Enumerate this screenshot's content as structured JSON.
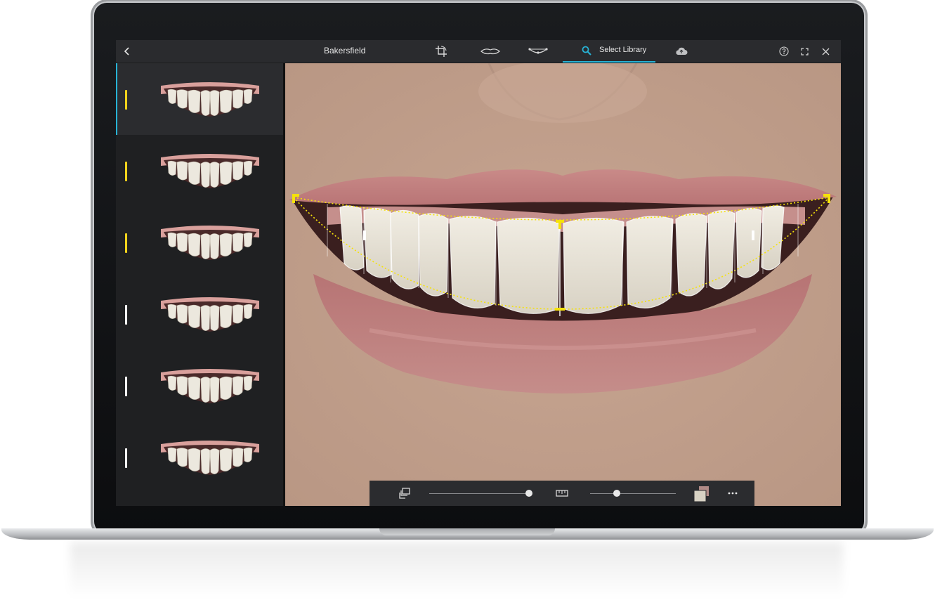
{
  "toolbar": {
    "back_icon": "chevron-left-icon",
    "title": "Bakersfield",
    "tools": [
      {
        "name": "crop-rotate-icon"
      },
      {
        "name": "lip-outline-icon"
      },
      {
        "name": "smile-curve-icon"
      }
    ],
    "active_tab_label": "Select Library",
    "active_tab_icon": "search-icon",
    "upload_icon": "cloud-upload-icon",
    "help_icon": "help-icon",
    "fullscreen_icon": "fullscreen-icon",
    "close_icon": "close-icon",
    "accent_color": "#27b3d6"
  },
  "library": {
    "items": [
      {
        "marker_color": "#f2d31b",
        "selected": true
      },
      {
        "marker_color": "#f2d31b",
        "selected": false
      },
      {
        "marker_color": "#f2d31b",
        "selected": false
      },
      {
        "marker_color": "#ffffff",
        "selected": false
      },
      {
        "marker_color": "#ffffff",
        "selected": false
      },
      {
        "marker_color": "#ffffff",
        "selected": false
      }
    ]
  },
  "viewer": {
    "guide_color": "#f5e20a"
  },
  "bottom_toolbar": {
    "layers_icon": "layers-icon",
    "opacity_slider_value": 0.98,
    "ruler_icon": "ruler-icon",
    "size_slider_value": 0.31,
    "color_swatch_icon": "color-swatch-icon",
    "more_icon": "more-icon"
  }
}
